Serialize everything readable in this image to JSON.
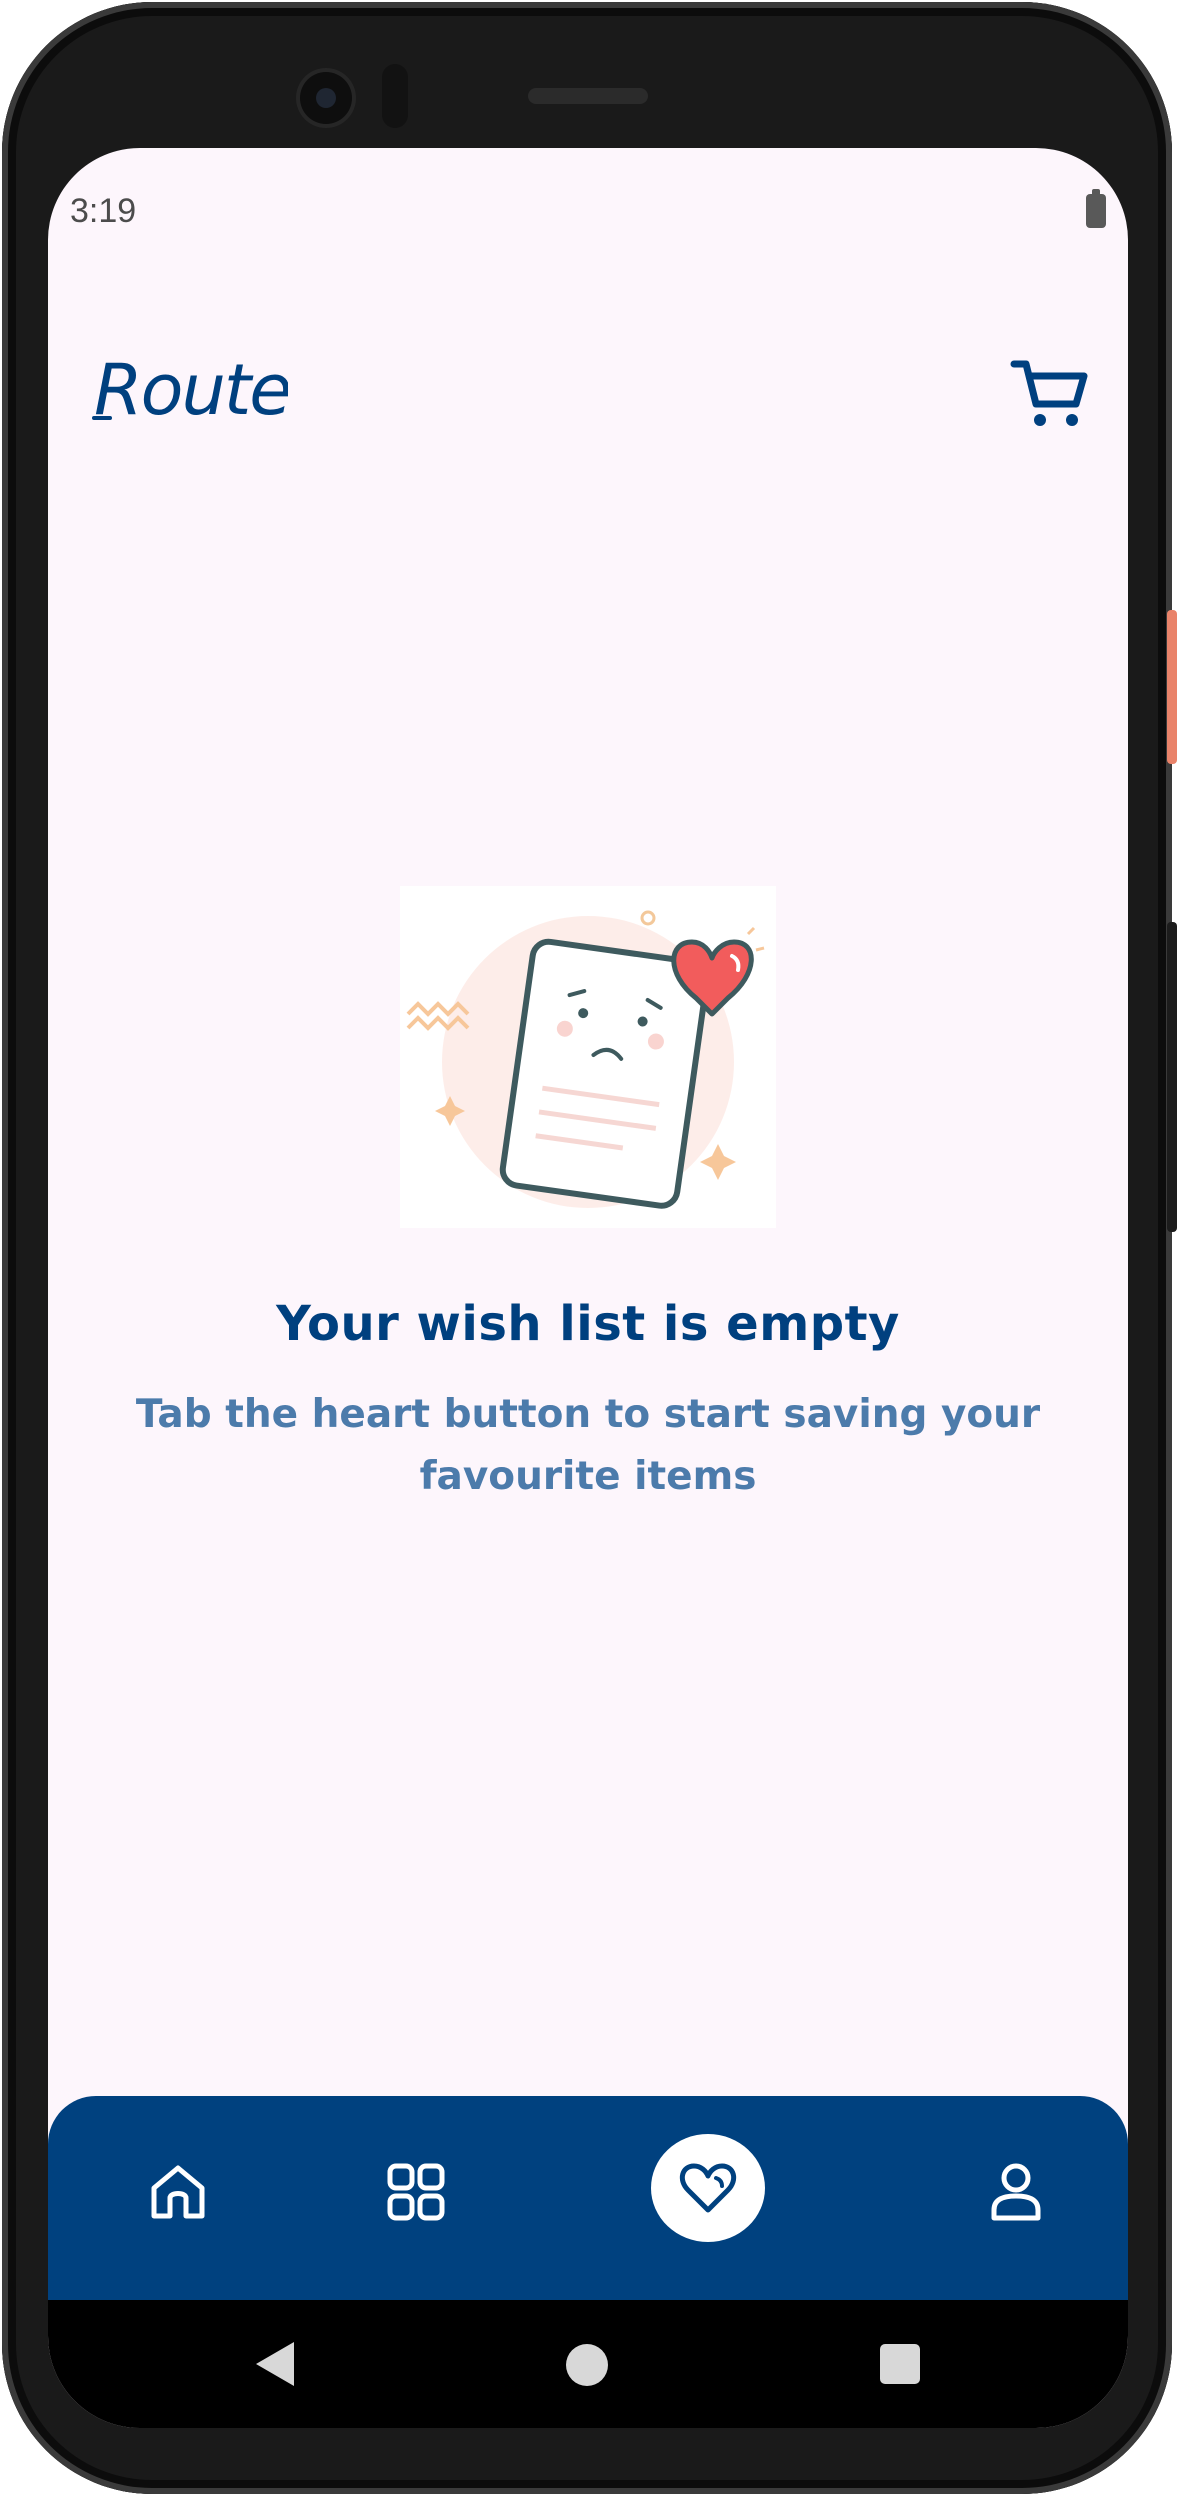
{
  "status_bar": {
    "time": "3:19",
    "battery_icon": "battery-icon"
  },
  "header": {
    "logo_text": "Route",
    "cart_icon": "cart-icon",
    "brand_color": "#00407f"
  },
  "empty_state": {
    "illustration_icon": "empty-wishlist-illustration",
    "title": "Your wish list is empty",
    "message": "Tab the heart button to start saving your favourite items"
  },
  "bottom_nav": {
    "background": "#00417f",
    "items": [
      {
        "name": "home",
        "icon": "home-icon",
        "active": false
      },
      {
        "name": "categories",
        "icon": "grid-icon",
        "active": false
      },
      {
        "name": "wishlist",
        "icon": "heart-icon",
        "active": true
      },
      {
        "name": "profile",
        "icon": "user-icon",
        "active": false
      }
    ]
  },
  "system_nav": {
    "back_icon": "back-icon",
    "home_icon": "home-circle-icon",
    "recents_icon": "recents-icon"
  }
}
